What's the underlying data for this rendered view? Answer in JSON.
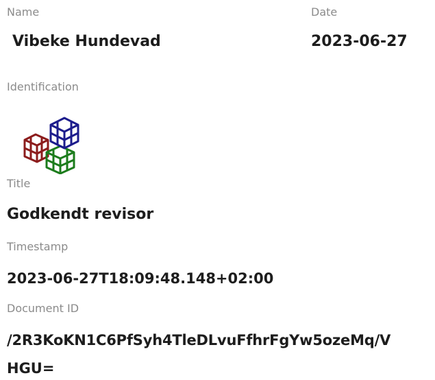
{
  "signer": {
    "name_label": "Name",
    "name_value": "Vibeke Hundevad",
    "date_label": "Date",
    "date_value": "2023-06-27"
  },
  "identification": {
    "label": "Identification",
    "logo_icon": "cube-cluster-logo-icon",
    "logo_colors": {
      "blue": "#1c1c8c",
      "red": "#8c1c1c",
      "green": "#1c7c1c"
    }
  },
  "title": {
    "label": "Title",
    "value": "Godkendt revisor"
  },
  "timestamp": {
    "label": "Timestamp",
    "value": "2023-06-27T18:09:48.148+02:00"
  },
  "document": {
    "label": "Document ID",
    "value_line1": "/2R3KoKN1C6PfSyh4TleDLvuFfhrFgYw5ozeMq/V",
    "value_line2": "HGU="
  }
}
